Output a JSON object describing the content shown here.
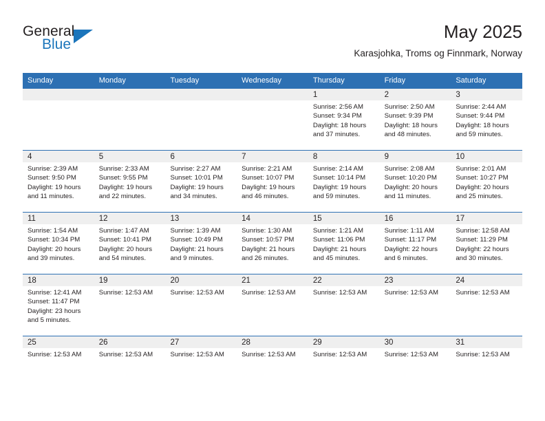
{
  "logo": {
    "word_top": "General",
    "word_bottom": "Blue",
    "triangle_color": "#1b75bb"
  },
  "header": {
    "title": "May 2025",
    "subtitle": "Karasjohka, Troms og Finnmark, Norway"
  },
  "theme": {
    "header_blue": "#2d70b3",
    "day_band_gray": "#efefef",
    "text": "#231f20"
  },
  "calendar": {
    "day_names": [
      "Sunday",
      "Monday",
      "Tuesday",
      "Wednesday",
      "Thursday",
      "Friday",
      "Saturday"
    ],
    "weeks": [
      [
        {
          "day": "",
          "lines": []
        },
        {
          "day": "",
          "lines": []
        },
        {
          "day": "",
          "lines": []
        },
        {
          "day": "",
          "lines": []
        },
        {
          "day": "1",
          "lines": [
            "Sunrise: 2:56 AM",
            "Sunset: 9:34 PM",
            "Daylight: 18 hours",
            "and 37 minutes."
          ]
        },
        {
          "day": "2",
          "lines": [
            "Sunrise: 2:50 AM",
            "Sunset: 9:39 PM",
            "Daylight: 18 hours",
            "and 48 minutes."
          ]
        },
        {
          "day": "3",
          "lines": [
            "Sunrise: 2:44 AM",
            "Sunset: 9:44 PM",
            "Daylight: 18 hours",
            "and 59 minutes."
          ]
        }
      ],
      [
        {
          "day": "4",
          "lines": [
            "Sunrise: 2:39 AM",
            "Sunset: 9:50 PM",
            "Daylight: 19 hours",
            "and 11 minutes."
          ]
        },
        {
          "day": "5",
          "lines": [
            "Sunrise: 2:33 AM",
            "Sunset: 9:55 PM",
            "Daylight: 19 hours",
            "and 22 minutes."
          ]
        },
        {
          "day": "6",
          "lines": [
            "Sunrise: 2:27 AM",
            "Sunset: 10:01 PM",
            "Daylight: 19 hours",
            "and 34 minutes."
          ]
        },
        {
          "day": "7",
          "lines": [
            "Sunrise: 2:21 AM",
            "Sunset: 10:07 PM",
            "Daylight: 19 hours",
            "and 46 minutes."
          ]
        },
        {
          "day": "8",
          "lines": [
            "Sunrise: 2:14 AM",
            "Sunset: 10:14 PM",
            "Daylight: 19 hours",
            "and 59 minutes."
          ]
        },
        {
          "day": "9",
          "lines": [
            "Sunrise: 2:08 AM",
            "Sunset: 10:20 PM",
            "Daylight: 20 hours",
            "and 11 minutes."
          ]
        },
        {
          "day": "10",
          "lines": [
            "Sunrise: 2:01 AM",
            "Sunset: 10:27 PM",
            "Daylight: 20 hours",
            "and 25 minutes."
          ]
        }
      ],
      [
        {
          "day": "11",
          "lines": [
            "Sunrise: 1:54 AM",
            "Sunset: 10:34 PM",
            "Daylight: 20 hours",
            "and 39 minutes."
          ]
        },
        {
          "day": "12",
          "lines": [
            "Sunrise: 1:47 AM",
            "Sunset: 10:41 PM",
            "Daylight: 20 hours",
            "and 54 minutes."
          ]
        },
        {
          "day": "13",
          "lines": [
            "Sunrise: 1:39 AM",
            "Sunset: 10:49 PM",
            "Daylight: 21 hours",
            "and 9 minutes."
          ]
        },
        {
          "day": "14",
          "lines": [
            "Sunrise: 1:30 AM",
            "Sunset: 10:57 PM",
            "Daylight: 21 hours",
            "and 26 minutes."
          ]
        },
        {
          "day": "15",
          "lines": [
            "Sunrise: 1:21 AM",
            "Sunset: 11:06 PM",
            "Daylight: 21 hours",
            "and 45 minutes."
          ]
        },
        {
          "day": "16",
          "lines": [
            "Sunrise: 1:11 AM",
            "Sunset: 11:17 PM",
            "Daylight: 22 hours",
            "and 6 minutes."
          ]
        },
        {
          "day": "17",
          "lines": [
            "Sunrise: 12:58 AM",
            "Sunset: 11:29 PM",
            "Daylight: 22 hours",
            "and 30 minutes."
          ]
        }
      ],
      [
        {
          "day": "18",
          "lines": [
            "Sunrise: 12:41 AM",
            "Sunset: 11:47 PM",
            "Daylight: 23 hours",
            "and 5 minutes."
          ]
        },
        {
          "day": "19",
          "lines": [
            "Sunrise: 12:53 AM"
          ]
        },
        {
          "day": "20",
          "lines": [
            "Sunrise: 12:53 AM"
          ]
        },
        {
          "day": "21",
          "lines": [
            "Sunrise: 12:53 AM"
          ]
        },
        {
          "day": "22",
          "lines": [
            "Sunrise: 12:53 AM"
          ]
        },
        {
          "day": "23",
          "lines": [
            "Sunrise: 12:53 AM"
          ]
        },
        {
          "day": "24",
          "lines": [
            "Sunrise: 12:53 AM"
          ]
        }
      ],
      [
        {
          "day": "25",
          "lines": [
            "Sunrise: 12:53 AM"
          ]
        },
        {
          "day": "26",
          "lines": [
            "Sunrise: 12:53 AM"
          ]
        },
        {
          "day": "27",
          "lines": [
            "Sunrise: 12:53 AM"
          ]
        },
        {
          "day": "28",
          "lines": [
            "Sunrise: 12:53 AM"
          ]
        },
        {
          "day": "29",
          "lines": [
            "Sunrise: 12:53 AM"
          ]
        },
        {
          "day": "30",
          "lines": [
            "Sunrise: 12:53 AM"
          ]
        },
        {
          "day": "31",
          "lines": [
            "Sunrise: 12:53 AM"
          ]
        }
      ]
    ]
  }
}
